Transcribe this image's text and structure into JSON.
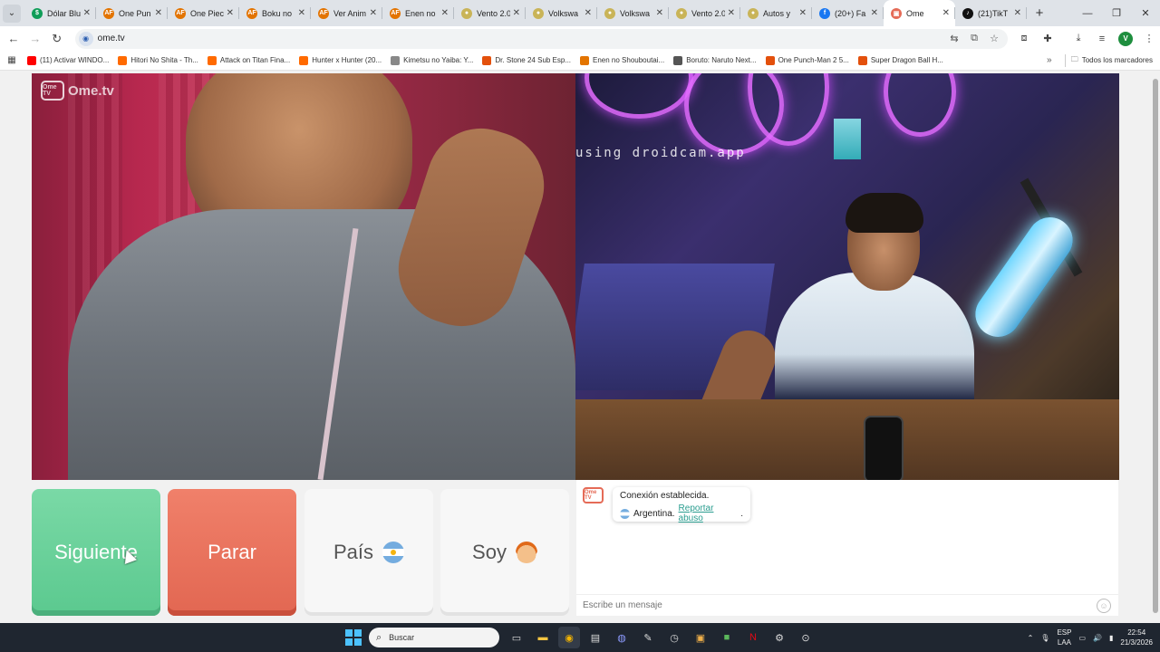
{
  "browser": {
    "tabs": [
      {
        "title": "Dólar Blu",
        "color": "#0f9d58",
        "glyph": "$"
      },
      {
        "title": "One Pun",
        "color": "#e37400",
        "glyph": "AF"
      },
      {
        "title": "One Piec",
        "color": "#e37400",
        "glyph": "AF"
      },
      {
        "title": "Boku no",
        "color": "#e37400",
        "glyph": "AF"
      },
      {
        "title": "Ver Anim",
        "color": "#e37400",
        "glyph": "AF"
      },
      {
        "title": "Enen no",
        "color": "#e37400",
        "glyph": "AF"
      },
      {
        "title": "Vento 2.0",
        "color": "#c9b458",
        "glyph": "●"
      },
      {
        "title": "Volkswa",
        "color": "#c9b458",
        "glyph": "●"
      },
      {
        "title": "Volkswa",
        "color": "#c9b458",
        "glyph": "●"
      },
      {
        "title": "Vento 2.0",
        "color": "#c9b458",
        "glyph": "●"
      },
      {
        "title": "Autos y",
        "color": "#c9b458",
        "glyph": "●"
      },
      {
        "title": "(20+) Fa",
        "color": "#1877f2",
        "glyph": "f"
      },
      {
        "title": "Ome",
        "color": "#e56b57",
        "glyph": "▣",
        "active": true
      },
      {
        "title": "(21)TikT",
        "color": "#111111",
        "glyph": "♪"
      }
    ],
    "url": "ome.tv",
    "profile_initial": "V",
    "bookmarks": [
      {
        "label": "(11) Activar WINDO...",
        "color": "#ff0000"
      },
      {
        "label": "Hitori No Shita - Th...",
        "color": "#ff6a00"
      },
      {
        "label": "Attack on Titan Fina...",
        "color": "#ff6a00"
      },
      {
        "label": "Hunter x Hunter (20...",
        "color": "#ff6a00"
      },
      {
        "label": "Kimetsu no Yaiba: Y...",
        "color": "#888888"
      },
      {
        "label": "Dr. Stone 24 Sub Esp...",
        "color": "#e3500c"
      },
      {
        "label": "Enen no Shouboutai...",
        "color": "#e37400"
      },
      {
        "label": "Boruto: Naruto Next...",
        "color": "#555555"
      },
      {
        "label": "One Punch-Man 2 5...",
        "color": "#e3500c"
      },
      {
        "label": "Super Dragon Ball H...",
        "color": "#e3500c"
      }
    ],
    "bookmarks_folder": "Todos los marcadores"
  },
  "ometv": {
    "logo_text": "Ome.tv",
    "logo_badge": "Ome TV",
    "remote_watermark": "using droidcam.app",
    "buttons": {
      "next": "Siguiente",
      "stop": "Parar",
      "country": "País",
      "gender": "Soy"
    },
    "chat": {
      "system_line1": "Conexión establecida.",
      "country": "Argentina.",
      "report_link": "Reportar abuso",
      "report_suffix": ".",
      "input_placeholder": "Escribe un mensaje"
    }
  },
  "taskbar": {
    "search_placeholder": "Buscar",
    "lang_line1": "ESP",
    "lang_line2": "LAA",
    "time": "22:54",
    "date": "21/3/2026"
  }
}
